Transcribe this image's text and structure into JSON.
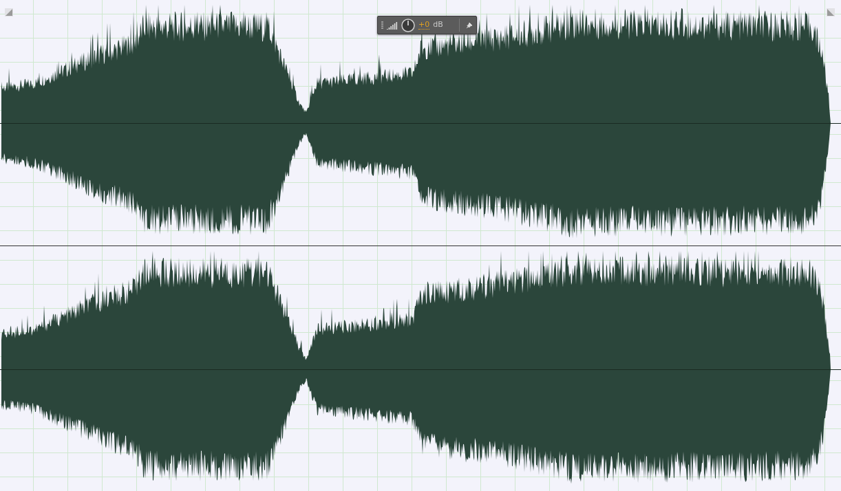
{
  "channels": [
    {
      "kind": "waveform"
    },
    {
      "kind": "waveform"
    }
  ],
  "hud": {
    "gain": "+0",
    "unit": "dB"
  }
}
